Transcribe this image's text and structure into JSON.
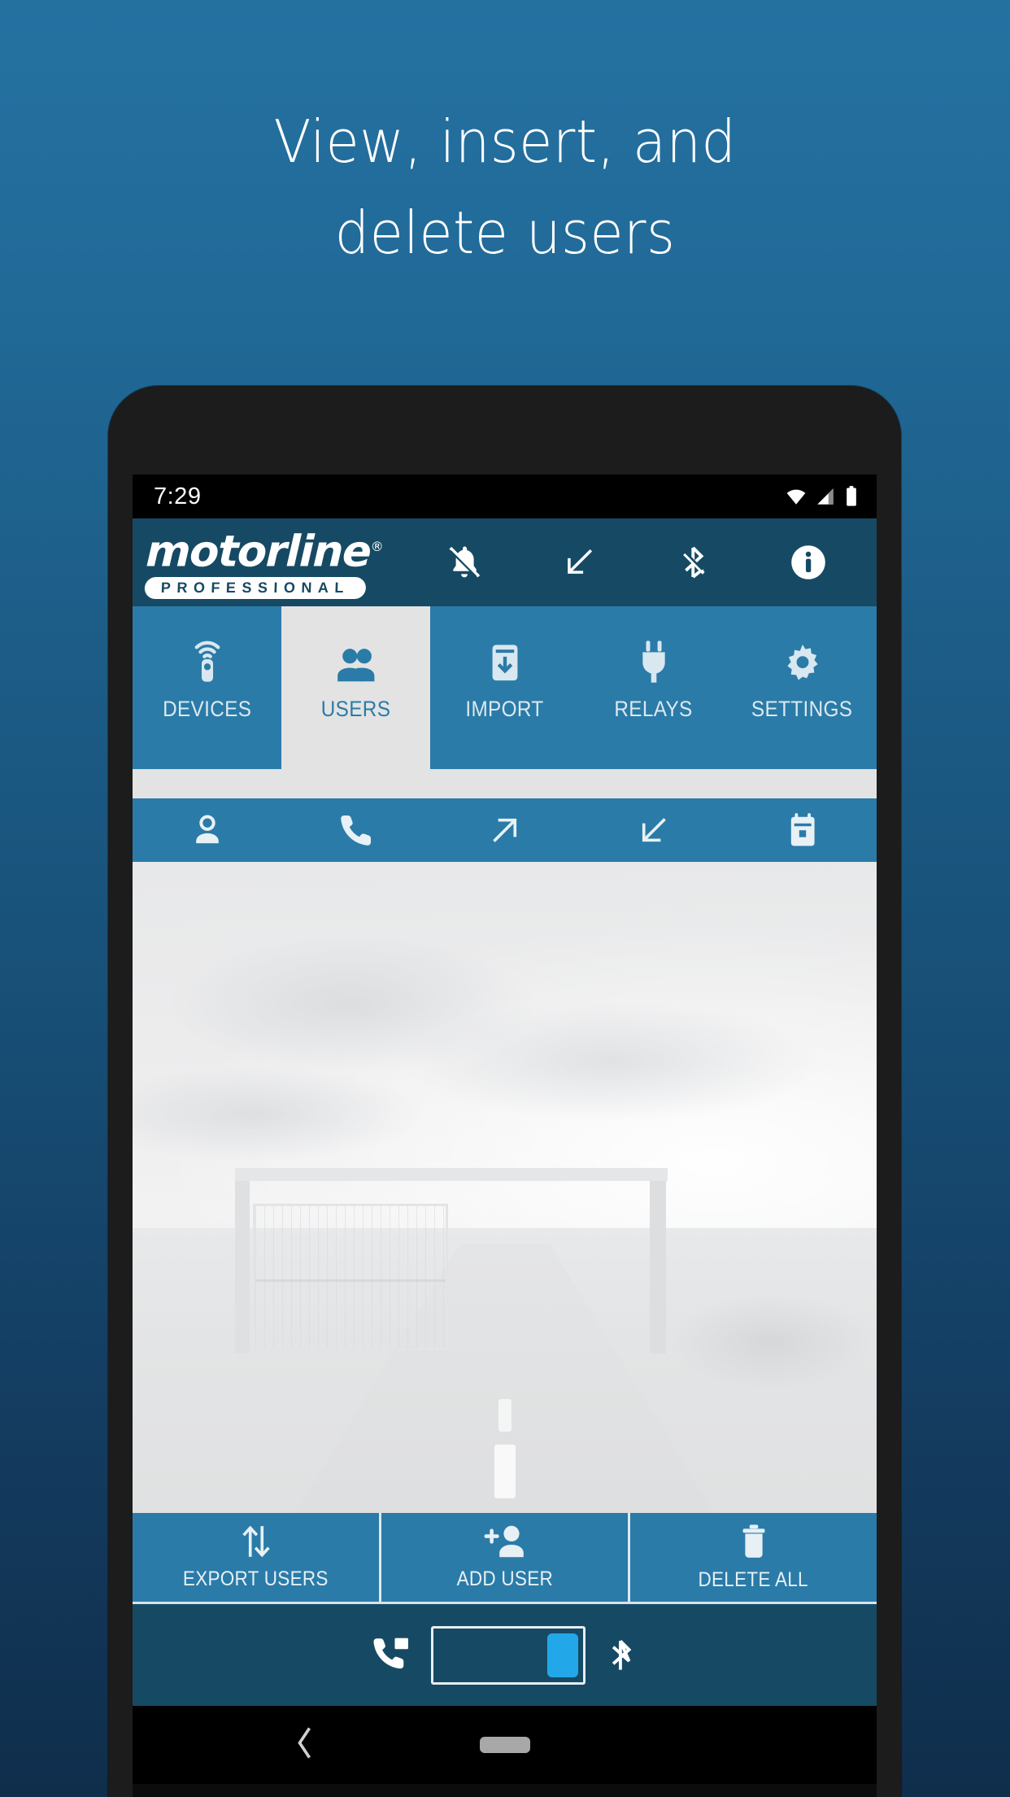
{
  "promo": {
    "headline_line1": "View, insert, and",
    "headline_line2": "delete users",
    "bg_top_color": "#2471a0",
    "bg_bottom_color": "#0f2e4c"
  },
  "status_bar": {
    "time": "7:29",
    "icons": [
      "wifi-icon",
      "cellular-signal-icon",
      "battery-icon"
    ]
  },
  "app_header": {
    "brand": "motorline",
    "brand_mark": "®",
    "brand_sub": "PROFESSIONAL",
    "background_color": "#164a64",
    "actions": [
      {
        "name": "notifications-off-icon",
        "label": "Notifications off"
      },
      {
        "name": "download-arrow-icon",
        "label": "Receive"
      },
      {
        "name": "bluetooth-off-icon",
        "label": "Bluetooth off"
      },
      {
        "name": "info-icon",
        "label": "Info"
      }
    ]
  },
  "tabs": {
    "accent_color": "#2a7ba8",
    "selected_background": "#e3e3e3",
    "selected_index": 1,
    "items": [
      {
        "label": "DEVICES",
        "icon": "remote-control-icon"
      },
      {
        "label": "USERS",
        "icon": "users-icon"
      },
      {
        "label": "IMPORT",
        "icon": "import-box-icon"
      },
      {
        "label": "RELAYS",
        "icon": "power-plug-icon"
      },
      {
        "label": "SETTINGS",
        "icon": "gear-icon"
      }
    ]
  },
  "sub_toolbar": {
    "items": [
      {
        "icon": "person-icon",
        "label": "User name"
      },
      {
        "icon": "phone-icon",
        "label": "Phone number"
      },
      {
        "icon": "arrow-up-right-icon",
        "label": "Outgoing"
      },
      {
        "icon": "arrow-down-left-icon",
        "label": "Incoming"
      },
      {
        "icon": "calendar-icon",
        "label": "Date"
      }
    ]
  },
  "content": {
    "background_image": "faded-garage-gate-photo",
    "empty_list": true
  },
  "bottom_actions": [
    {
      "label": "EXPORT USERS",
      "icon": "sort-arrows-icon"
    },
    {
      "label": "ADD USER",
      "icon": "person-add-icon"
    },
    {
      "label": "DELETE ALL",
      "icon": "trash-icon"
    }
  ],
  "connection_strip": {
    "left_icon": "phone-call-icon",
    "right_icon": "bluetooth-icon",
    "toggle_position": "right",
    "thumb_color": "#22a8e8",
    "background_color": "#164a64"
  },
  "nav_bar": {
    "back_icon": "back-chevron-icon",
    "home_icon": "home-pill-icon"
  }
}
